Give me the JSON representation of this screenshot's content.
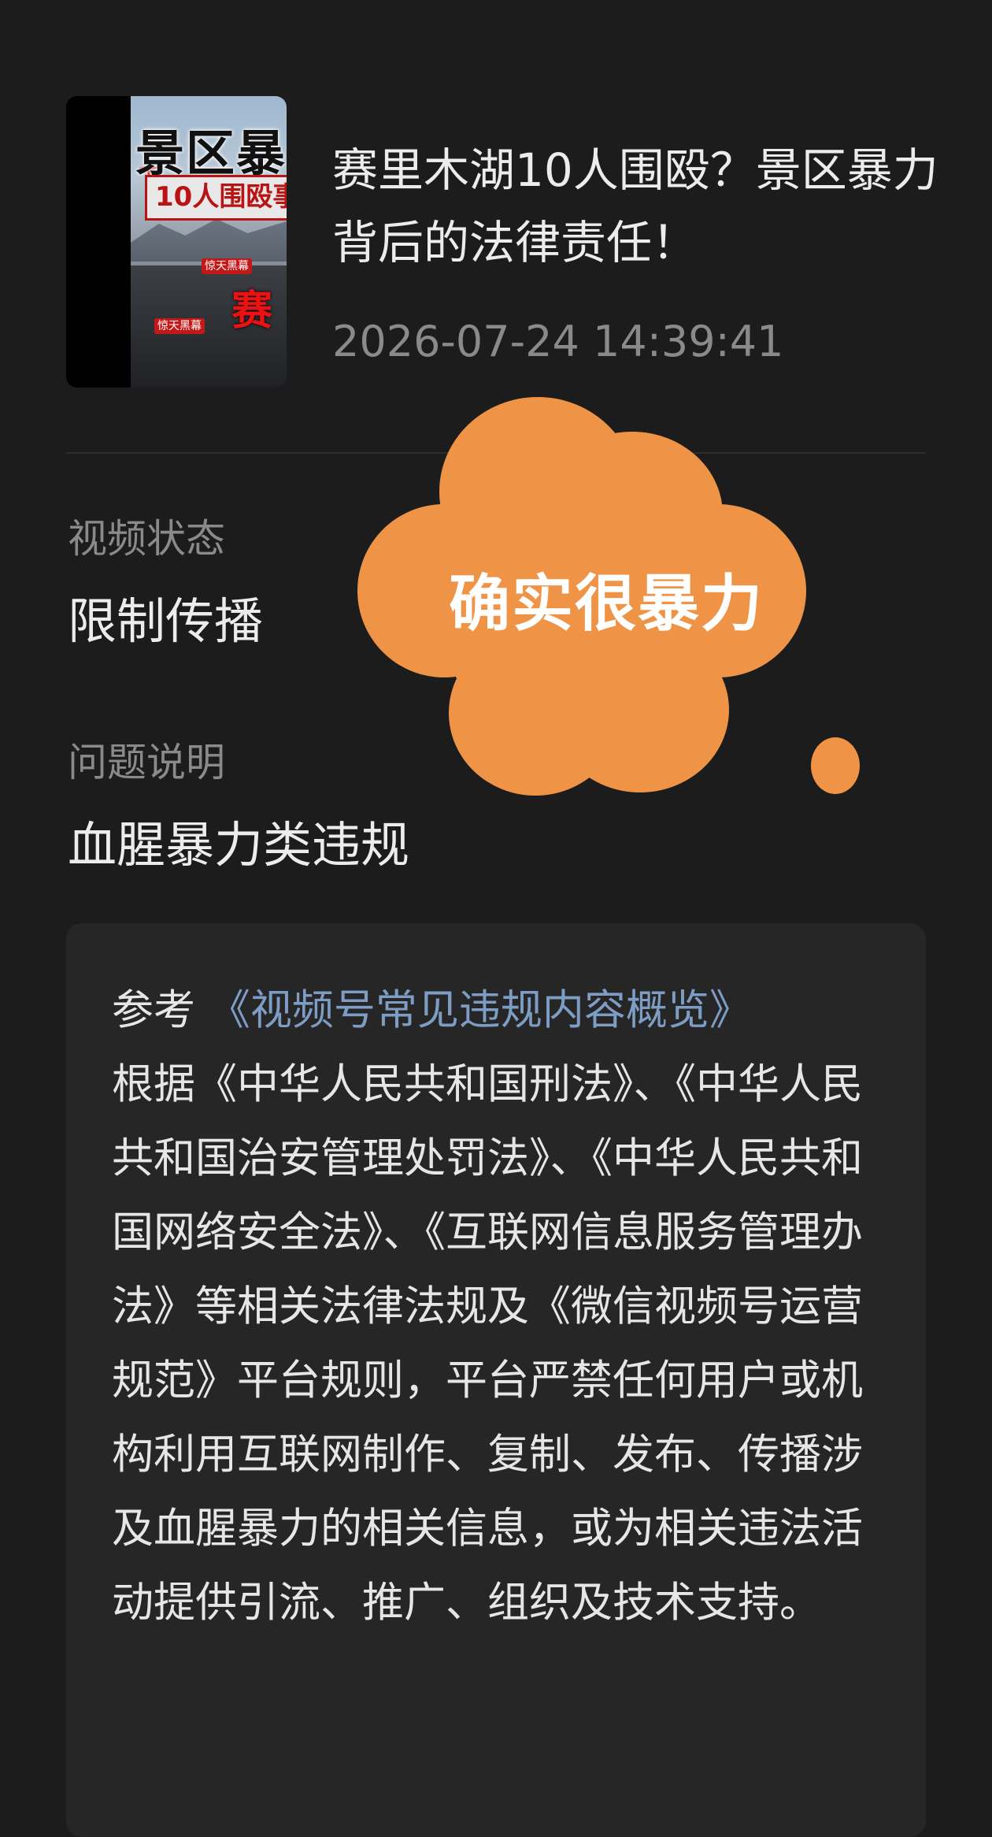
{
  "thumbnail": {
    "title_text": "景区暴",
    "subtitle_text": "10人围殴事",
    "tag_1": "惊天黑幕",
    "tag_2": "惊天黑幕",
    "red_char": "赛"
  },
  "video": {
    "title": "赛里木湖10人围殴？景区暴力背后的法律责任！",
    "timestamp": "2026-07-24 14:39:41"
  },
  "status": {
    "label": "视频状态",
    "value": "限制传播"
  },
  "issue": {
    "label": "问题说明",
    "value": "血腥暴力类违规"
  },
  "reference": {
    "prefix": "参考",
    "link_text": "《视频号常见违规内容概览》",
    "body": "根据《中华人民共和国刑法》、《中华人民共和国治安管理处罚法》、《中华人民共和国网络安全法》、《互联网信息服务管理办法》等相关法律法规及《微信视频号运营规范》平台规则，平台严禁任何用户或机构利用互联网制作、复制、发布、传播涉及血腥暴力的相关信息，或为相关违法活动提供引流、推广、组织及技术支持。"
  },
  "overlay": {
    "cloud_text": "确实很暴力"
  },
  "colors": {
    "background": "#1c1c1c",
    "card": "#262626",
    "link": "#7d9dc4",
    "cloud": "#ef9447",
    "muted_text": "#8a8a8a"
  }
}
